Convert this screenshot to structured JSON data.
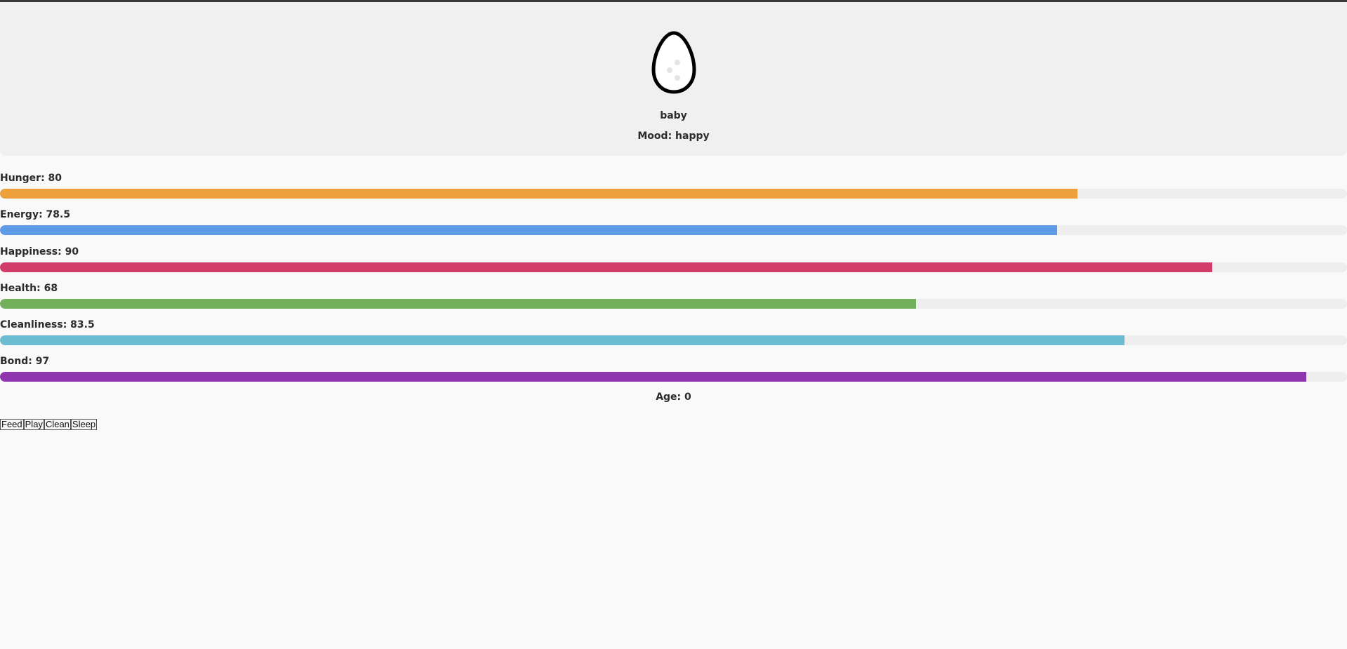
{
  "pet": {
    "icon": "egg-icon",
    "stage": "baby",
    "mood_label": "Mood: happy"
  },
  "stats": [
    {
      "label": "Hunger: 80",
      "value": 80,
      "color": "#eda03b"
    },
    {
      "label": "Energy: 78.5",
      "value": 78.5,
      "color": "#5d9be6"
    },
    {
      "label": "Happiness: 90",
      "value": 90,
      "color": "#d23c6a"
    },
    {
      "label": "Health: 68",
      "value": 68,
      "color": "#72b05c"
    },
    {
      "label": "Cleanliness: 83.5",
      "value": 83.5,
      "color": "#6bbcd2"
    },
    {
      "label": "Bond: 97",
      "value": 97,
      "color": "#8e34ad"
    }
  ],
  "age_label": "Age: 0",
  "actions": {
    "feed": "Feed",
    "play": "Play",
    "clean": "Clean",
    "sleep": "Sleep"
  }
}
